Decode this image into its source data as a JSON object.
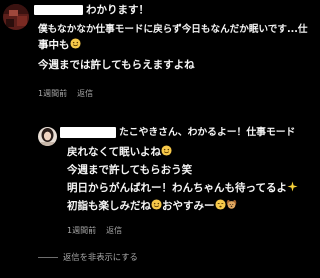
{
  "comment1": {
    "text_line1": "わかります！",
    "text_line2": "僕もなかなか仕事モードに戻らず今日もなんだか眠いです...仕",
    "text_line3": "事中も",
    "text_line4": "今週までは許してもらえますよね",
    "timestamp": "1週間前",
    "reply_label": "返信"
  },
  "reply1": {
    "text_line1": "たこやきさん、わかるよー！仕事モード",
    "text_line2": "戻れなくて眠いよね",
    "text_line3": "今週まで許してもらおう笑",
    "text_line4": "明日からがんばれー！わんちゃんも待ってるよ",
    "text_line5": "初詣も楽しみだね",
    "text_line6": "おやすみー",
    "timestamp": "1週間前",
    "reply_label": "返信"
  },
  "hide_replies": {
    "label": "返信を非表示にする"
  },
  "colors": {
    "background": "#000000",
    "text": "#f5f5f5",
    "meta": "#a8a8a8",
    "emoji_face": "#f7c94a"
  },
  "icons": [
    "smile-emoji-icon",
    "sparkles-icon",
    "sleepy-emoji-icon",
    "dog-emoji-icon"
  ]
}
